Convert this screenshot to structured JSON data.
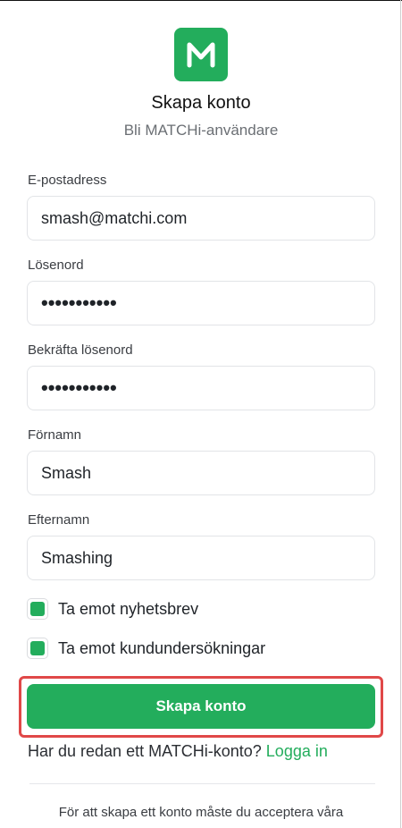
{
  "brand": {
    "accent": "#23ad5c",
    "logo_letter": "M"
  },
  "header": {
    "title": "Skapa konto",
    "subtitle": "Bli MATCHi-användare"
  },
  "form": {
    "email": {
      "label": "E-postadress",
      "value": "smash@matchi.com"
    },
    "password": {
      "label": "Lösenord",
      "value": "•••••••••••"
    },
    "confirm_password": {
      "label": "Bekräfta lösenord",
      "value": "•••••••••••"
    },
    "first_name": {
      "label": "Förnamn",
      "value": "Smash"
    },
    "last_name": {
      "label": "Efternamn",
      "value": "Smashing"
    },
    "checkboxes": [
      {
        "label": "Ta emot nyhetsbrev",
        "checked": true
      },
      {
        "label": "Ta emot kundundersökningar",
        "checked": true
      }
    ],
    "submit_label": "Skapa konto"
  },
  "login_prompt": {
    "text": "Har du redan ett MATCHi-konto?",
    "link": "Logga in"
  },
  "footer": {
    "text": "För att skapa ett konto måste du acceptera våra"
  }
}
